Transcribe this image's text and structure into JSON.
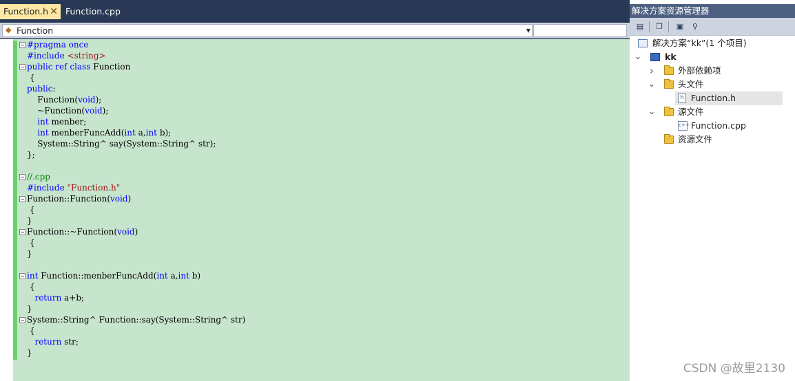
{
  "editor": {
    "tabs": [
      {
        "label": "Function.h",
        "active": true
      },
      {
        "label": "Function.cpp",
        "active": false
      }
    ],
    "close_glyph": "✕",
    "member_dropdown": {
      "value": "Function",
      "icon": "class-icon"
    },
    "accent_color": "#ffe8a6",
    "code_background": "#c7e5cd",
    "lines": [
      {
        "fold": true,
        "parts": [
          {
            "t": "pp",
            "v": "#pragma once"
          }
        ]
      },
      {
        "fold": false,
        "parts": [
          {
            "t": "pp",
            "v": "#include "
          },
          {
            "t": "str",
            "v": "<string>"
          }
        ]
      },
      {
        "fold": true,
        "parts": [
          {
            "t": "kw",
            "v": "public ref class"
          },
          {
            "t": "",
            "v": " Function"
          }
        ]
      },
      {
        "fold": false,
        "parts": [
          {
            "t": "",
            "v": " {"
          }
        ]
      },
      {
        "fold": false,
        "parts": [
          {
            "t": "kw",
            "v": "public"
          },
          {
            "t": "",
            "v": ":"
          }
        ]
      },
      {
        "fold": false,
        "parts": [
          {
            "t": "",
            "v": "    Function("
          },
          {
            "t": "kw",
            "v": "void"
          },
          {
            "t": "",
            "v": ");"
          }
        ]
      },
      {
        "fold": false,
        "parts": [
          {
            "t": "",
            "v": "    ~Function("
          },
          {
            "t": "kw",
            "v": "void"
          },
          {
            "t": "",
            "v": ");"
          }
        ]
      },
      {
        "fold": false,
        "parts": [
          {
            "t": "",
            "v": "    "
          },
          {
            "t": "kw",
            "v": "int"
          },
          {
            "t": "",
            "v": " menber;"
          }
        ]
      },
      {
        "fold": false,
        "parts": [
          {
            "t": "",
            "v": "    "
          },
          {
            "t": "kw",
            "v": "int"
          },
          {
            "t": "",
            "v": " menberFuncAdd("
          },
          {
            "t": "kw",
            "v": "int"
          },
          {
            "t": "",
            "v": " a,"
          },
          {
            "t": "kw",
            "v": "int"
          },
          {
            "t": "",
            "v": " b);"
          }
        ]
      },
      {
        "fold": false,
        "parts": [
          {
            "t": "",
            "v": "    System::String^ say(System::String^ str);"
          }
        ]
      },
      {
        "fold": false,
        "parts": [
          {
            "t": "",
            "v": "};"
          }
        ]
      },
      {
        "fold": false,
        "parts": [
          {
            "t": "",
            "v": ""
          }
        ]
      },
      {
        "fold": true,
        "parts": [
          {
            "t": "cm",
            "v": "//.cpp"
          }
        ]
      },
      {
        "fold": false,
        "parts": [
          {
            "t": "pp",
            "v": "#include "
          },
          {
            "t": "str",
            "v": "\"Function.h\""
          }
        ]
      },
      {
        "fold": true,
        "parts": [
          {
            "t": "",
            "v": "Function::Function("
          },
          {
            "t": "kw",
            "v": "void"
          },
          {
            "t": "",
            "v": ")"
          }
        ]
      },
      {
        "fold": false,
        "parts": [
          {
            "t": "",
            "v": " {"
          }
        ]
      },
      {
        "fold": false,
        "parts": [
          {
            "t": "",
            "v": "}"
          }
        ]
      },
      {
        "fold": true,
        "parts": [
          {
            "t": "",
            "v": "Function::~Function("
          },
          {
            "t": "kw",
            "v": "void"
          },
          {
            "t": "",
            "v": ")"
          }
        ]
      },
      {
        "fold": false,
        "parts": [
          {
            "t": "",
            "v": " {"
          }
        ]
      },
      {
        "fold": false,
        "parts": [
          {
            "t": "",
            "v": "}"
          }
        ]
      },
      {
        "fold": false,
        "parts": [
          {
            "t": "",
            "v": ""
          }
        ]
      },
      {
        "fold": true,
        "parts": [
          {
            "t": "kw",
            "v": "int"
          },
          {
            "t": "",
            "v": " Function::menberFuncAdd("
          },
          {
            "t": "kw",
            "v": "int"
          },
          {
            "t": "",
            "v": " a,"
          },
          {
            "t": "kw",
            "v": "int"
          },
          {
            "t": "",
            "v": " b)"
          }
        ]
      },
      {
        "fold": false,
        "parts": [
          {
            "t": "",
            "v": " {"
          }
        ]
      },
      {
        "fold": false,
        "parts": [
          {
            "t": "",
            "v": "   "
          },
          {
            "t": "kw",
            "v": "return"
          },
          {
            "t": "",
            "v": " a+b;"
          }
        ]
      },
      {
        "fold": false,
        "parts": [
          {
            "t": "",
            "v": "}"
          }
        ]
      },
      {
        "fold": true,
        "parts": [
          {
            "t": "",
            "v": "System::String^ Function::say(System::String^ str)"
          }
        ]
      },
      {
        "fold": false,
        "parts": [
          {
            "t": "",
            "v": " {"
          }
        ]
      },
      {
        "fold": false,
        "parts": [
          {
            "t": "",
            "v": "   "
          },
          {
            "t": "kw",
            "v": "return"
          },
          {
            "t": "",
            "v": " str;"
          }
        ]
      },
      {
        "fold": false,
        "parts": [
          {
            "t": "",
            "v": "}"
          }
        ]
      }
    ]
  },
  "explorer": {
    "title": "解决方案资源管理器",
    "toolbar": [
      {
        "icon": "properties-icon",
        "glyph": "▤"
      },
      {
        "icon": "show-all-files-icon",
        "glyph": "❐"
      },
      {
        "icon": "refresh-icon",
        "glyph": "▣"
      },
      {
        "icon": "class-view-icon",
        "glyph": "⚲"
      }
    ],
    "tree": [
      {
        "label": "解决方案“kk”(1 个项目)",
        "level": 0,
        "icon": "solution",
        "expander": "",
        "bold": false,
        "selected": false
      },
      {
        "label": "kk",
        "level": 0,
        "icon": "project",
        "expander": "⌄",
        "bold": true,
        "selected": false
      },
      {
        "label": "外部依赖项",
        "level": 1,
        "icon": "folder",
        "expander": "›",
        "bold": false,
        "selected": false
      },
      {
        "label": "头文件",
        "level": 1,
        "icon": "folder",
        "expander": "⌄",
        "bold": false,
        "selected": false
      },
      {
        "label": "Function.h",
        "level": 2,
        "icon": "h",
        "expander": "",
        "bold": false,
        "selected": true
      },
      {
        "label": "源文件",
        "level": 1,
        "icon": "folder",
        "expander": "⌄",
        "bold": false,
        "selected": false
      },
      {
        "label": "Function.cpp",
        "level": 2,
        "icon": "cpp",
        "expander": "",
        "bold": false,
        "selected": false
      },
      {
        "label": "资源文件",
        "level": 1,
        "icon": "folder",
        "expander": "",
        "bold": false,
        "selected": false
      }
    ]
  },
  "watermark": "CSDN @故里2130"
}
